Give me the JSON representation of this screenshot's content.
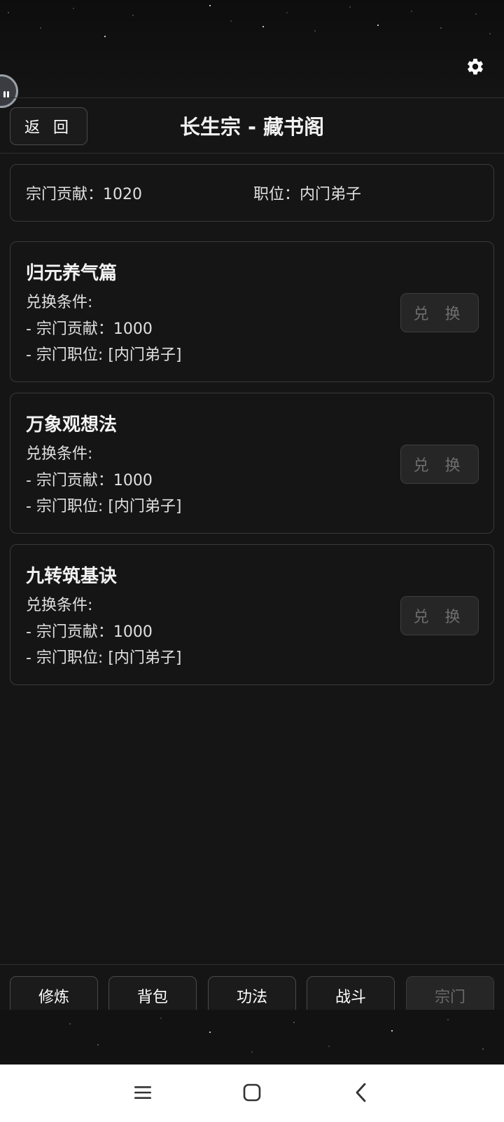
{
  "header": {
    "back_label": "返 回",
    "title": "长生宗 - 藏书阁"
  },
  "status": {
    "contribution": "宗门贡献：1020",
    "position": "职位：内门弟子"
  },
  "skills": [
    {
      "name": "归元养气篇",
      "condition_title": "兑换条件:",
      "req_contribution": "- 宗门贡献：1000",
      "req_position": "- 宗门职位: [内门弟子]",
      "button_label": "兑 换"
    },
    {
      "name": "万象观想法",
      "condition_title": "兑换条件:",
      "req_contribution": "- 宗门贡献：1000",
      "req_position": "- 宗门职位: [内门弟子]",
      "button_label": "兑 换"
    },
    {
      "name": "九转筑基诀",
      "condition_title": "兑换条件:",
      "req_contribution": "- 宗门贡献：1000",
      "req_position": "- 宗门职位: [内门弟子]",
      "button_label": "兑 换"
    }
  ],
  "bottom_nav": {
    "items": [
      {
        "label": "修炼"
      },
      {
        "label": "背包"
      },
      {
        "label": "功法"
      },
      {
        "label": "战斗"
      },
      {
        "label": "宗门",
        "active": true
      }
    ]
  },
  "icons": {
    "settings": "gear-icon",
    "floating": "floating-ball-icon",
    "sys_menu": "menu-icon",
    "sys_home": "home-icon",
    "sys_back": "back-icon"
  },
  "colors": {
    "background": "#151515",
    "card_border": "#3a3a3a",
    "disabled_button_bg": "#262626",
    "disabled_text": "#6e6e6e",
    "system_nav_bg": "#ffffff"
  }
}
